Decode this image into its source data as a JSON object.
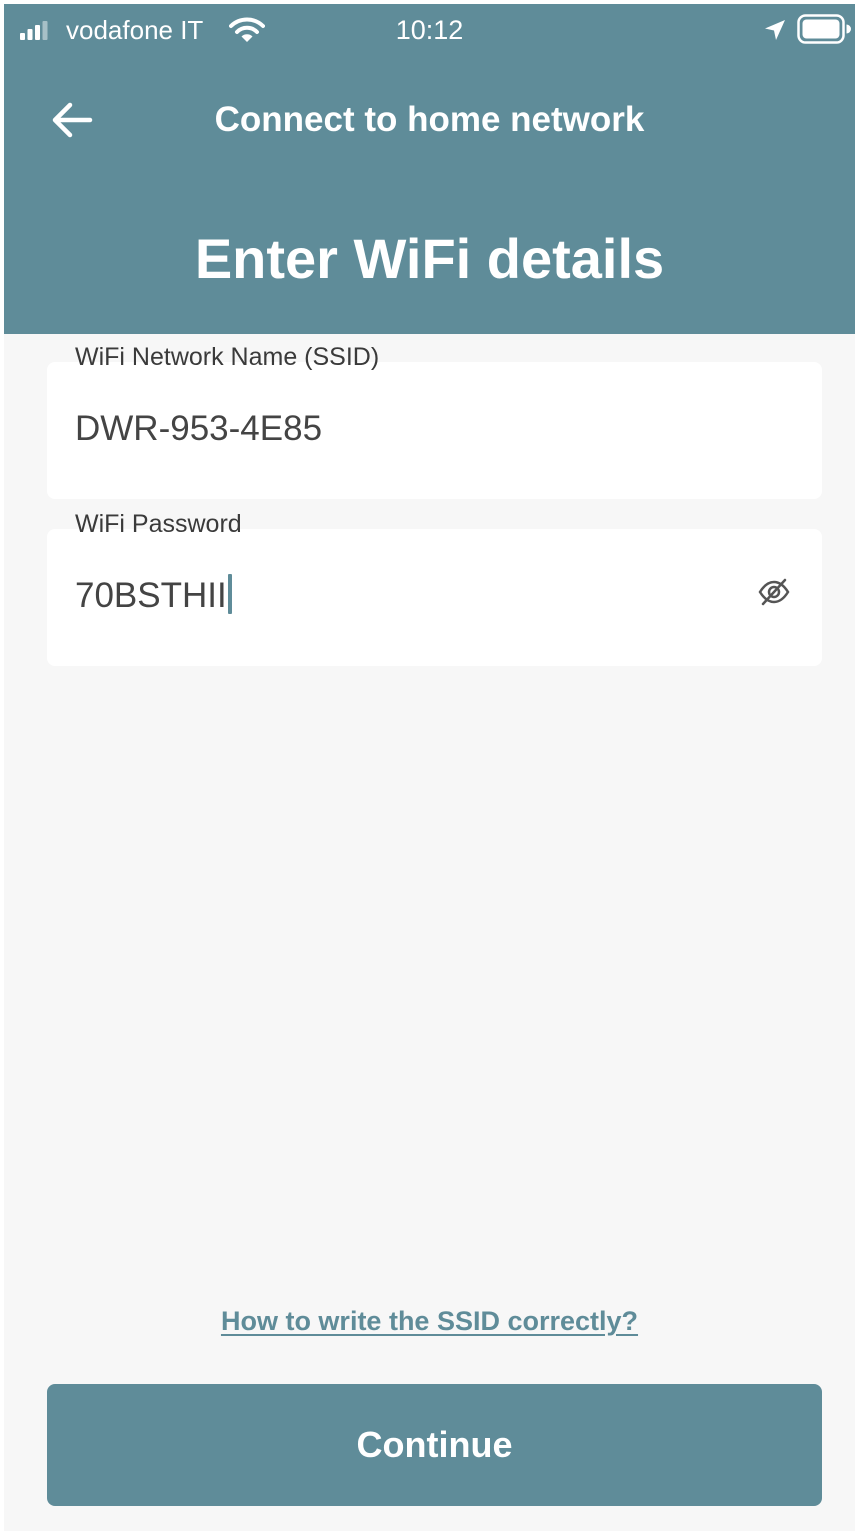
{
  "status_bar": {
    "carrier": "vodafone IT",
    "time": "10:12"
  },
  "nav": {
    "title": "Connect to home network"
  },
  "page": {
    "heading": "Enter WiFi details"
  },
  "form": {
    "ssid": {
      "label": "WiFi Network Name (SSID)",
      "value": "DWR-953-4E85"
    },
    "password": {
      "label": "WiFi Password",
      "value": "70BSTHII"
    }
  },
  "help_link": "How to write the SSID correctly?",
  "continue_label": "Continue",
  "icons": {
    "back": "arrow-left-icon",
    "visibility": "eye-off-icon",
    "signal": "cellular-signal-icon",
    "wifi": "wifi-icon",
    "location": "location-arrow-icon",
    "battery": "battery-icon"
  },
  "colors": {
    "primary": "#5f8c99",
    "background": "#f7f7f7",
    "field_background": "#ffffff",
    "text": "#444444"
  }
}
